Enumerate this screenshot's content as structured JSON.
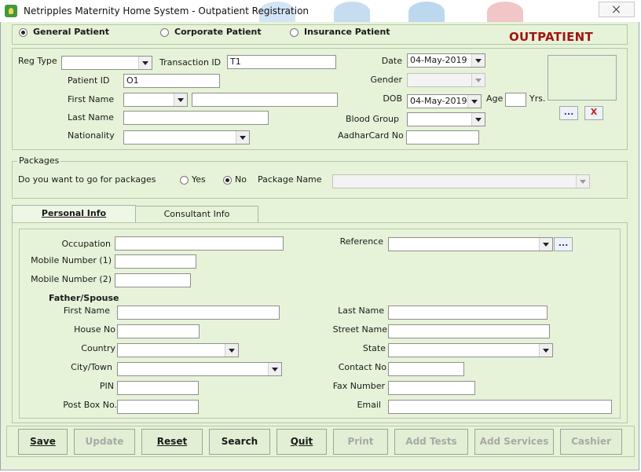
{
  "window": {
    "title": "Netripples Maternity Home System - Outpatient Registration"
  },
  "patient_type": {
    "options": [
      "General Patient",
      "Corporate Patient",
      "Insurance Patient"
    ],
    "selected": "General Patient",
    "banner": "OUTPATIENT"
  },
  "registration": {
    "reg_type_label": "Reg Type",
    "reg_type_value": "",
    "transaction_id_label": "Transaction ID",
    "transaction_id_value": "T1",
    "date_label": "Date",
    "date_value": "04-May-2019",
    "patient_id_label": "Patient ID",
    "patient_id_value": "O1",
    "gender_label": "Gender",
    "gender_value": "",
    "first_name_label": "First Name",
    "first_name_prefix": "",
    "first_name_value": "",
    "dob_label": "DOB",
    "dob_value": "04-May-2019",
    "age_label": "Age",
    "age_value": "",
    "yrs_label": "Yrs.",
    "last_name_label": "Last Name",
    "last_name_value": "",
    "blood_group_label": "Blood Group",
    "blood_group_value": "",
    "nationality_label": "Nationality",
    "nationality_value": "",
    "aadhar_label": "AadharCard No",
    "aadhar_value": "",
    "browse_photo_label": "...",
    "clear_photo_label": "X"
  },
  "packages": {
    "legend": "Packages",
    "question": "Do you want to go for packages",
    "yes_label": "Yes",
    "no_label": "No",
    "selected": "No",
    "package_name_label": "Package Name",
    "package_name_value": ""
  },
  "tabs": [
    {
      "label": "Personal Info",
      "active": true
    },
    {
      "label": "Consultant Info",
      "active": false
    }
  ],
  "personal": {
    "occupation_label": "Occupation",
    "occupation_value": "",
    "reference_label": "Reference",
    "reference_value": "",
    "reference_browse": "...",
    "mobile1_label": "Mobile Number (1)",
    "mobile1_value": "",
    "mobile2_label": "Mobile Number (2)",
    "mobile2_value": "",
    "father_spouse_header": "Father/Spouse",
    "fs_first_name_label": "First Name",
    "fs_first_name_value": "",
    "fs_last_name_label": "Last Name",
    "fs_last_name_value": "",
    "house_no_label": "House No",
    "house_no_value": "",
    "street_name_label": "Street Name",
    "street_name_value": "",
    "country_label": "Country",
    "country_value": "",
    "state_label": "State",
    "state_value": "",
    "city_label": "City/Town",
    "city_value": "",
    "contact_no_label": "Contact No",
    "contact_no_value": "",
    "pin_label": "PIN",
    "pin_value": "",
    "fax_label": "Fax Number",
    "fax_value": "",
    "post_box_label": "Post Box No.",
    "post_box_value": "",
    "email_label": "Email",
    "email_value": ""
  },
  "actions": {
    "save": "Save",
    "update": "Update",
    "reset": "Reset",
    "search": "Search",
    "quit": "Quit",
    "print": "Print",
    "add_tests": "Add Tests",
    "add_services": "Add Services",
    "cashier": "Cashier"
  },
  "colors": {
    "background": "#e6f3d8",
    "banner": "#a31414"
  }
}
